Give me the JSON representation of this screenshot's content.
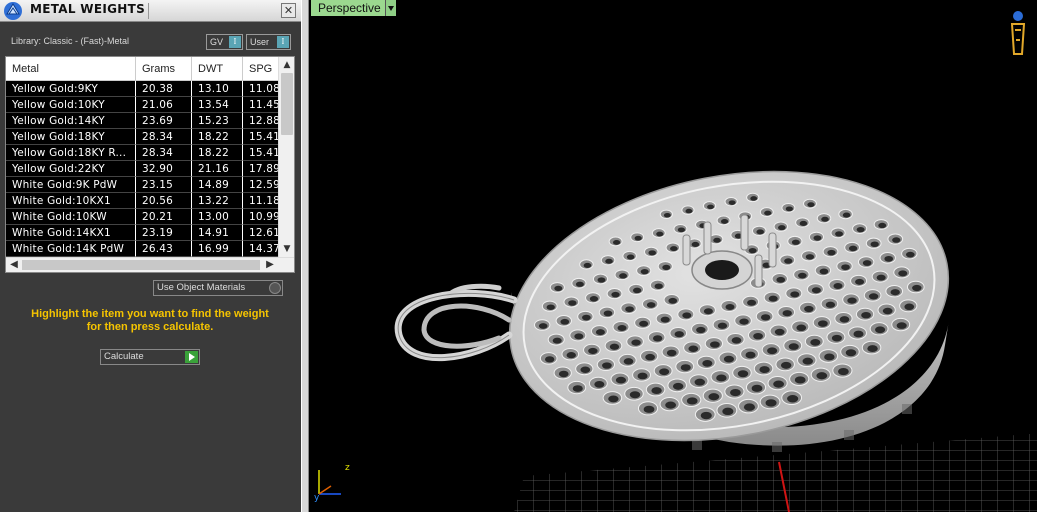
{
  "panel": {
    "title": "METAL WEIGHTS",
    "close_glyph": "✕",
    "library_label": "Library: Classic - (Fast)-Metal",
    "dropdown_gv": "GV",
    "dropdown_user": "User",
    "columns": [
      "Metal",
      "Grams",
      "DWT",
      "SPG"
    ],
    "rows": [
      [
        "Yellow Gold:9KY",
        "20.38",
        "13.10",
        "11.08"
      ],
      [
        "Yellow Gold:10KY",
        "21.06",
        "13.54",
        "11.45"
      ],
      [
        "Yellow Gold:14KY",
        "23.69",
        "15.23",
        "12.88"
      ],
      [
        "Yellow Gold:18KY",
        "28.34",
        "18.22",
        "15.41"
      ],
      [
        "Yellow Gold:18KY R...",
        "28.34",
        "18.22",
        "15.41"
      ],
      [
        "Yellow Gold:22KY",
        "32.90",
        "21.16",
        "17.89"
      ],
      [
        "White Gold:9K PdW",
        "23.15",
        "14.89",
        "12.59"
      ],
      [
        "White Gold:10KX1",
        "20.56",
        "13.22",
        "11.18"
      ],
      [
        "White Gold:10KW",
        "20.21",
        "13.00",
        "10.99"
      ],
      [
        "White Gold:14KX1",
        "23.19",
        "14.91",
        "12.61"
      ],
      [
        "White Gold:14K PdW",
        "26.43",
        "16.99",
        "14.37"
      ]
    ],
    "use_object_materials_label": "Use Object Materials",
    "instructions_line1": "Highlight the item you want to find the weight",
    "instructions_line2": "for then press calculate.",
    "calculate_label": "Calculate"
  },
  "viewport": {
    "view_name": "Perspective",
    "axis_z_label": "z",
    "axis_y_label": "y"
  },
  "colors": {
    "instructions_text": "#f5c400",
    "viewport_tab": "#9bd88f",
    "calculate_go": "#3aa23a",
    "dropdown_arrow": "#5aa5b5"
  },
  "icons": {
    "logo": "diamond-logo-icon",
    "close": "close-icon",
    "navigator": "navigator-figure-icon"
  }
}
